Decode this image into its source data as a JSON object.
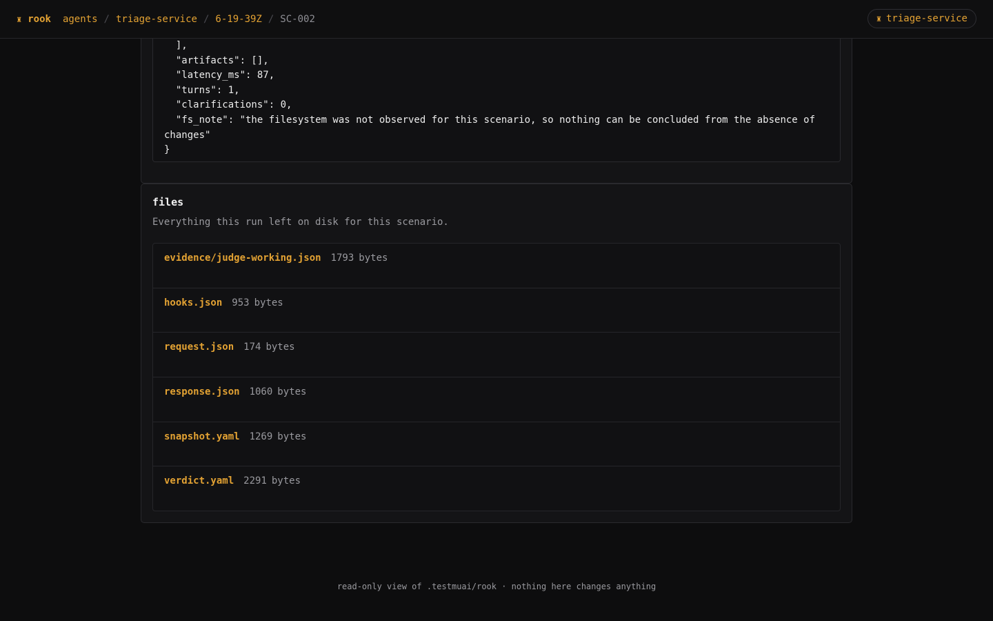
{
  "topbar": {
    "brand": "rook",
    "brand_icon": "rook-chess-icon",
    "breadcrumbs": [
      "agents",
      "triage-service",
      "6-19-39Z",
      "SC-002"
    ],
    "separator": "/",
    "project_pill": "triage-service"
  },
  "code_panel": {
    "lines": [
      "  ],",
      "  \"artifacts\": [],",
      "  \"latency_ms\": 87,",
      "  \"turns\": 1,",
      "  \"clarifications\": 0,",
      "  \"fs_note\": \"the filesystem was not observed for this scenario, so nothing can be concluded from the absence of changes\"",
      "}"
    ]
  },
  "files": {
    "title": "files",
    "subtitle": "Everything this run left on disk for this scenario.",
    "unit": "bytes",
    "items": [
      {
        "name": "evidence/judge-working.json",
        "size": "1793"
      },
      {
        "name": "hooks.json",
        "size": "953"
      },
      {
        "name": "request.json",
        "size": "174"
      },
      {
        "name": "response.json",
        "size": "1060"
      },
      {
        "name": "snapshot.yaml",
        "size": "1269"
      },
      {
        "name": "verdict.yaml",
        "size": "2291"
      }
    ]
  },
  "footer": {
    "text": "read-only view of .testmuai/rook · nothing here changes anything"
  },
  "colors": {
    "accent": "#e3a233",
    "background": "#0d0d0e",
    "panel": "#141416",
    "muted_text": "#9a9a9f"
  }
}
